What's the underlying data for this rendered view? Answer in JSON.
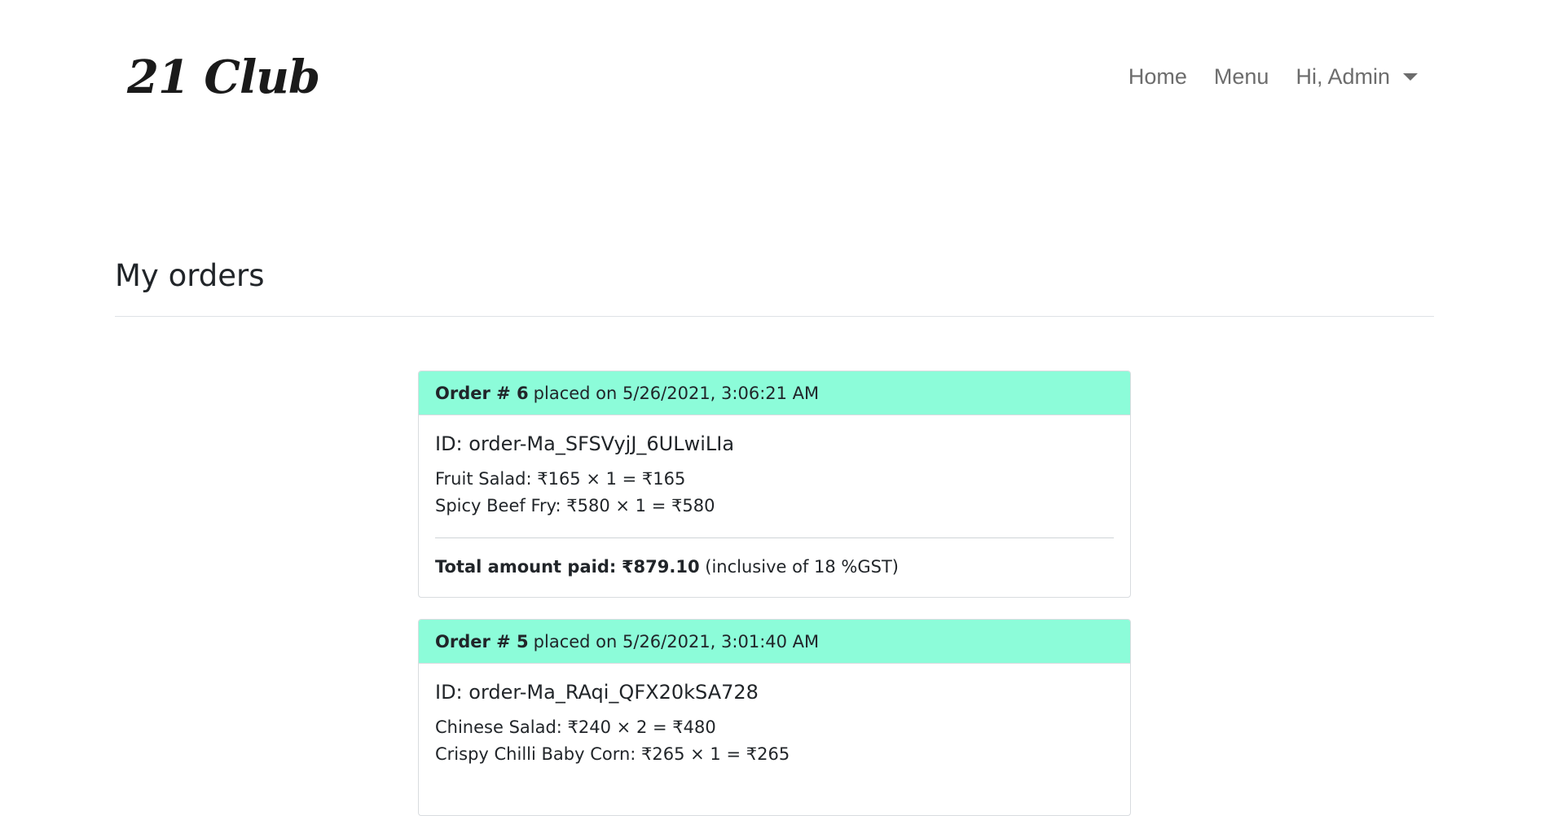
{
  "brand": {
    "name": "21 Club"
  },
  "nav": {
    "home": "Home",
    "menu": "Menu",
    "user": "Hi, Admin"
  },
  "page": {
    "title": "My orders"
  },
  "orders": [
    {
      "number_label": "Order # 6",
      "placed_label": "placed on 5/26/2021, 3:06:21 AM",
      "id_prefix": "ID:",
      "id": "order-Ma_SFSVyjJ_6ULwiLIa",
      "items": [
        "Fruit Salad: ₹165 × 1 = ₹165",
        "Spicy Beef Fry: ₹580 × 1 = ₹580"
      ],
      "total_label": "Total amount paid:",
      "total_value": "₹879.10",
      "total_note": "(inclusive of 18 %GST)"
    },
    {
      "number_label": "Order # 5",
      "placed_label": "placed on 5/26/2021, 3:01:40 AM",
      "id_prefix": "ID:",
      "id": "order-Ma_RAqi_QFX20kSA728",
      "items": [
        "Chinese Salad: ₹240 × 2 = ₹480",
        "Crispy Chilli Baby Corn: ₹265 × 1 = ₹265"
      ]
    }
  ],
  "colors": {
    "card_header": "#8cfcd9",
    "nav_text": "#6c6c6c",
    "text": "#212529"
  }
}
